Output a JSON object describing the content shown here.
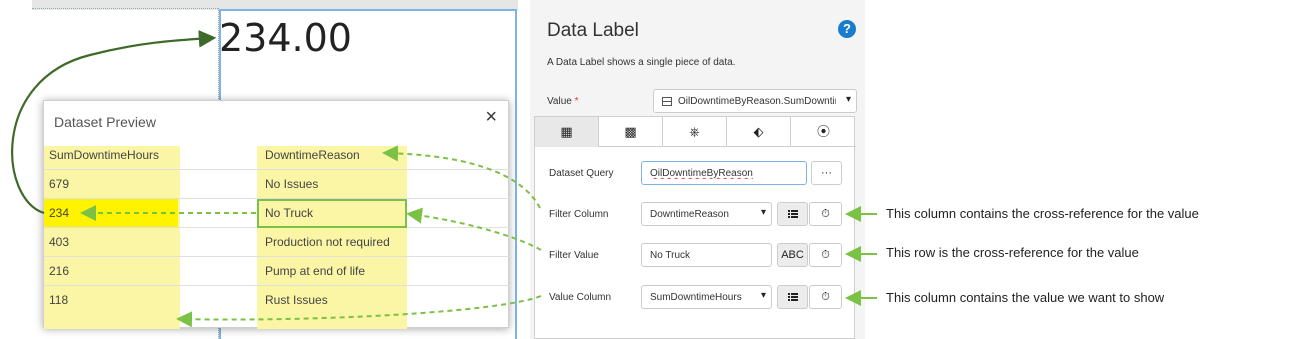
{
  "canvas": {
    "big_value": "234.00"
  },
  "dataset_preview": {
    "title": "Dataset Preview",
    "close_icon": "×",
    "columns": [
      "SumDowntimeHours",
      "DowntimeReason"
    ],
    "rows": [
      [
        "679",
        "No Issues"
      ],
      [
        "234",
        "No Truck"
      ],
      [
        "403",
        "Production not required"
      ],
      [
        "216",
        "Pump at end of life"
      ],
      [
        "118",
        "Rust Issues"
      ]
    ]
  },
  "panel": {
    "title": "Data Label",
    "help_icon": "?",
    "description": "A Data Label shows a single piece of data.",
    "value_label": "Value",
    "required_mark": "*",
    "value_select": "OilDowntimeByReason.SumDowntimeHours",
    "tabs": [
      {
        "icon": "table-icon",
        "glyph": "▦"
      },
      {
        "icon": "calculator-icon",
        "glyph": "▩"
      },
      {
        "icon": "network-icon",
        "glyph": "⎈"
      },
      {
        "icon": "tag-icon",
        "glyph": "⬖"
      },
      {
        "icon": "radio-target-icon",
        "glyph": "⦿"
      }
    ],
    "dataset_query_label": "Dataset Query",
    "dataset_query_value": "OilDowntimeByReason",
    "more_button": "···",
    "filter_column_label": "Filter Column",
    "filter_column_value": "DowntimeReason",
    "filter_value_label": "Filter Value",
    "filter_value_value": "No Truck",
    "abc_button": "ABC",
    "value_column_label": "Value Column",
    "value_column_value": "SumDowntimeHours",
    "caret": "▾",
    "timer_glyph": "⏱"
  },
  "annotations": [
    "This column contains the cross-reference for the value",
    "This row is the cross-reference for the value",
    "This column contains the value we want to show"
  ],
  "colors": {
    "highlight_column": "#fbf5a6",
    "highlight_cell": "#fff300",
    "arrow_green": "#7bc143",
    "arrow_dark_green": "#3f6b2a",
    "selection_blue": "#7fb2e5",
    "help_blue": "#1a7ccc"
  }
}
